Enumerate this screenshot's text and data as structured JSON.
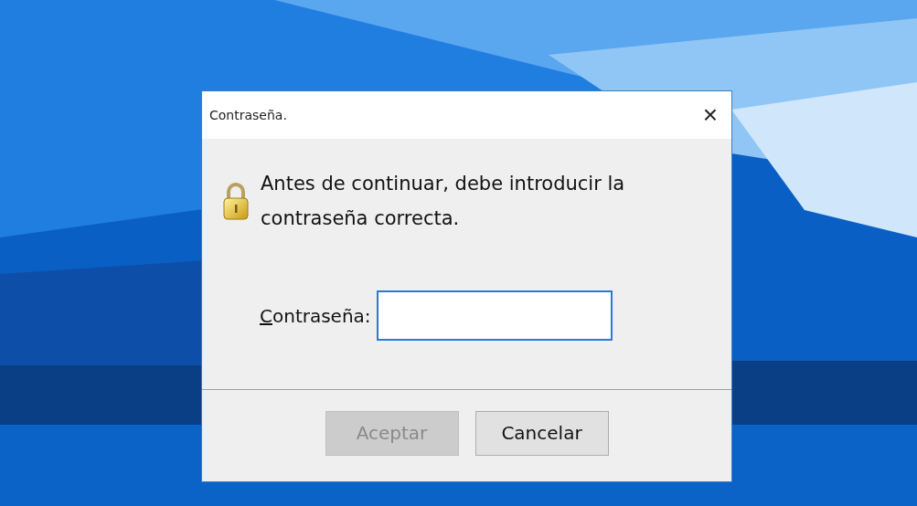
{
  "window": {
    "title": "Contraseña.",
    "close": "×"
  },
  "message": "Antes de continuar, debe introducir la contraseña correcta.",
  "password_field": {
    "label": "Contraseña:",
    "focused": true
  },
  "buttons": [
    {
      "label": "Aceptar",
      "disabled": true
    },
    {
      "label": "Cancelar",
      "disabled": false
    }
  ]
}
